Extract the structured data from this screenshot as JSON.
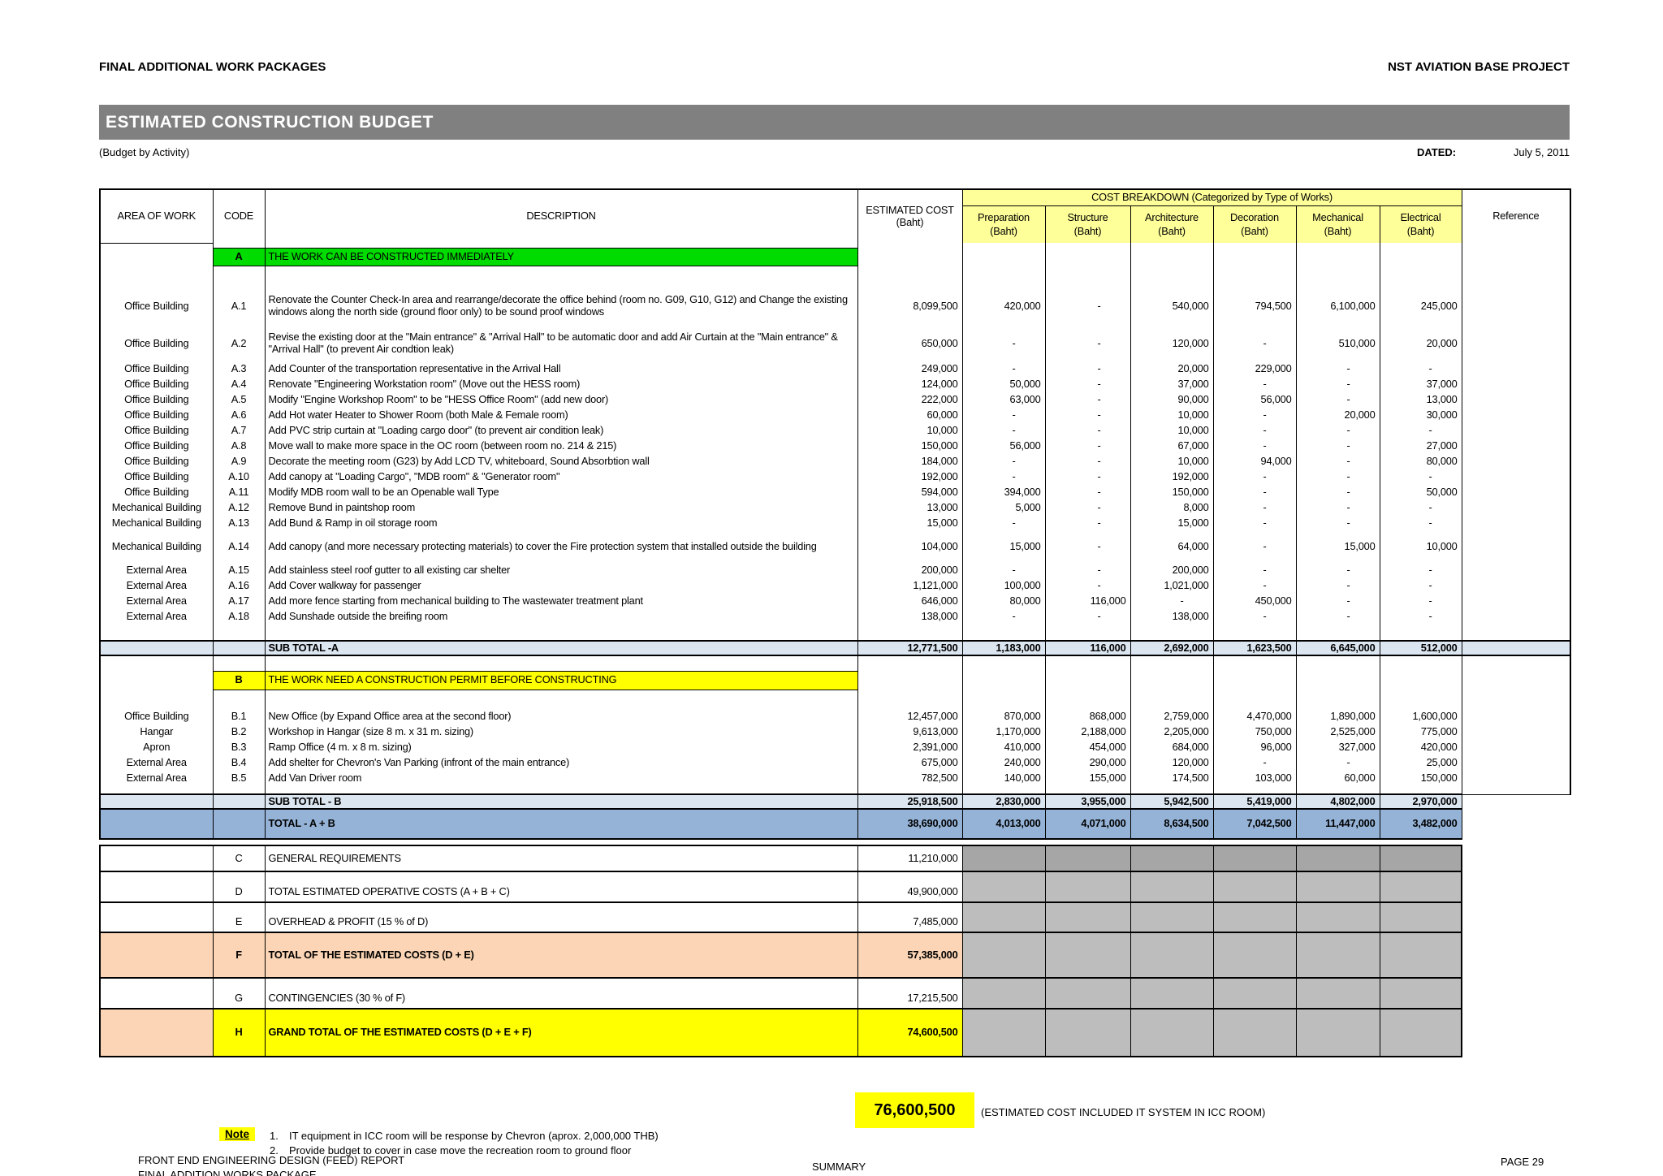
{
  "header": {
    "left_title": "FINAL ADDITIONAL WORK PACKAGES",
    "right_title": "NST AVIATION BASE PROJECT",
    "bar_title": "ESTIMATED CONSTRUCTION BUDGET",
    "subtitle": "(Budget by Activity)",
    "dated_label": "DATED:",
    "dated_value": "July 5, 2011"
  },
  "table": {
    "headers": {
      "area": "AREA OF WORK",
      "code": "CODE",
      "desc": "DESCRIPTION",
      "est_line1": "ESTIMATED COST",
      "est_line2": "(Baht)",
      "breakdown": "COST BREAKDOWN (Categorized by Type of Works)",
      "cols": [
        {
          "title": "Preparation",
          "unit": "(Baht)"
        },
        {
          "title": "Structure",
          "unit": "(Baht)"
        },
        {
          "title": "Architecture",
          "unit": "(Baht)"
        },
        {
          "title": "Decoration",
          "unit": "(Baht)"
        },
        {
          "title": "Mechanical",
          "unit": "(Baht)"
        },
        {
          "title": "Electrical",
          "unit": "(Baht)"
        }
      ],
      "reference": "Reference"
    },
    "section_a": {
      "code": "A",
      "title": "THE WORK CAN BE CONSTRUCTED IMMEDIATELY",
      "items": [
        {
          "area": "Office Building",
          "code": "A.1",
          "desc": "Renovate the Counter Check-In area and rearrange/decorate the office behind (room no. G09, G10, G12) and Change the existing windows along the north side (ground floor only) to be sound proof windows",
          "est": "8,099,500",
          "prep": "420,000",
          "str": "-",
          "arch": "540,000",
          "dec": "794,500",
          "mech": "6,100,000",
          "elec": "245,000"
        },
        {
          "area": "Office Building",
          "code": "A.2",
          "desc": "Revise the existing door at the \"Main entrance\" & \"Arrival Hall\" to be automatic door and add Air Curtain at the \"Main entrance\" & \"Arrival Hall\" (to prevent Air condtion leak)",
          "est": "650,000",
          "prep": "-",
          "str": "-",
          "arch": "120,000",
          "dec": "-",
          "mech": "510,000",
          "elec": "20,000"
        },
        {
          "area": "Office Building",
          "code": "A.3",
          "desc": "Add Counter of the transportation representative in the Arrival Hall",
          "est": "249,000",
          "prep": "-",
          "str": "-",
          "arch": "20,000",
          "dec": "229,000",
          "mech": "-",
          "elec": "-"
        },
        {
          "area": "Office Building",
          "code": "A.4",
          "desc": "Renovate \"Engineering Workstation room\" (Move out the HESS room)",
          "est": "124,000",
          "prep": "50,000",
          "str": "-",
          "arch": "37,000",
          "dec": "-",
          "mech": "-",
          "elec": "37,000"
        },
        {
          "area": "Office Building",
          "code": "A.5",
          "desc": "Modify \"Engine Workshop Room\" to be \"HESS Office Room\" (add new door)",
          "est": "222,000",
          "prep": "63,000",
          "str": "-",
          "arch": "90,000",
          "dec": "56,000",
          "mech": "-",
          "elec": "13,000"
        },
        {
          "area": "Office Building",
          "code": "A.6",
          "desc": "Add Hot water Heater to Shower Room (both Male & Female room)",
          "est": "60,000",
          "prep": "-",
          "str": "-",
          "arch": "10,000",
          "dec": "-",
          "mech": "20,000",
          "elec": "30,000"
        },
        {
          "area": "Office Building",
          "code": "A.7",
          "desc": "Add PVC strip curtain at \"Loading cargo door\" (to prevent air condition leak)",
          "est": "10,000",
          "prep": "-",
          "str": "-",
          "arch": "10,000",
          "dec": "-",
          "mech": "-",
          "elec": "-"
        },
        {
          "area": "Office Building",
          "code": "A.8",
          "desc": "Move wall to make more space in the OC room (between room no. 214 & 215)",
          "est": "150,000",
          "prep": "56,000",
          "str": "-",
          "arch": "67,000",
          "dec": "-",
          "mech": "-",
          "elec": "27,000"
        },
        {
          "area": "Office Building",
          "code": "A.9",
          "desc": "Decorate the meeting room (G23) by Add LCD TV, whiteboard, Sound Absorbtion wall",
          "est": "184,000",
          "prep": "-",
          "str": "-",
          "arch": "10,000",
          "dec": "94,000",
          "mech": "-",
          "elec": "80,000"
        },
        {
          "area": "Office Building",
          "code": "A.10",
          "desc": "Add canopy at \"Loading Cargo\", \"MDB room\" & \"Generator room\"",
          "est": "192,000",
          "prep": "-",
          "str": "-",
          "arch": "192,000",
          "dec": "-",
          "mech": "-",
          "elec": "-"
        },
        {
          "area": "Office Building",
          "code": "A.11",
          "desc": "Modify MDB room wall to be an Openable wall Type",
          "est": "594,000",
          "prep": "394,000",
          "str": "-",
          "arch": "150,000",
          "dec": "-",
          "mech": "-",
          "elec": "50,000"
        },
        {
          "area": "Mechanical Building",
          "code": "A.12",
          "desc": "Remove Bund in paintshop room",
          "est": "13,000",
          "prep": "5,000",
          "str": "-",
          "arch": "8,000",
          "dec": "-",
          "mech": "-",
          "elec": "-"
        },
        {
          "area": "Mechanical Building",
          "code": "A.13",
          "desc": "Add Bund & Ramp in oil storage room",
          "est": "15,000",
          "prep": "-",
          "str": "-",
          "arch": "15,000",
          "dec": "-",
          "mech": "-",
          "elec": "-"
        },
        {
          "area": "Mechanical Building",
          "code": "A.14",
          "desc": "Add canopy (and more necessary protecting materials) to cover the Fire protection system that installed outside the building",
          "est": "104,000",
          "prep": "15,000",
          "str": "-",
          "arch": "64,000",
          "dec": "-",
          "mech": "15,000",
          "elec": "10,000"
        },
        {
          "area": "External Area",
          "code": "A.15",
          "desc": "Add stainless steel roof gutter to all existing car shelter",
          "est": "200,000",
          "prep": "-",
          "str": "-",
          "arch": "200,000",
          "dec": "-",
          "mech": "-",
          "elec": "-"
        },
        {
          "area": "External Area",
          "code": "A.16",
          "desc": "Add Cover walkway for passenger",
          "est": "1,121,000",
          "prep": "100,000",
          "str": "-",
          "arch": "1,021,000",
          "dec": "-",
          "mech": "-",
          "elec": "-"
        },
        {
          "area": "External Area",
          "code": "A.17",
          "desc": "Add more fence starting from mechanical building to The wastewater treatment plant",
          "est": "646,000",
          "prep": "80,000",
          "str": "116,000",
          "arch": "-",
          "dec": "450,000",
          "mech": "-",
          "elec": "-"
        },
        {
          "area": "External Area",
          "code": "A.18",
          "desc": "Add Sunshade outside the breifing room",
          "est": "138,000",
          "prep": "-",
          "str": "-",
          "arch": "138,000",
          "dec": "-",
          "mech": "-",
          "elec": "-"
        }
      ],
      "subtotal": {
        "label": "SUB TOTAL -A",
        "est": "12,771,500",
        "prep": "1,183,000",
        "str": "116,000",
        "arch": "2,692,000",
        "dec": "1,623,500",
        "mech": "6,645,000",
        "elec": "512,000"
      }
    },
    "section_b": {
      "code": "B",
      "title": "THE WORK NEED A CONSTRUCTION PERMIT BEFORE CONSTRUCTING",
      "items": [
        {
          "area": "Office Building",
          "code": "B.1",
          "desc": "New Office (by Expand Office area at the second floor)",
          "est": "12,457,000",
          "prep": "870,000",
          "str": "868,000",
          "arch": "2,759,000",
          "dec": "4,470,000",
          "mech": "1,890,000",
          "elec": "1,600,000"
        },
        {
          "area": "Hangar",
          "code": "B.2",
          "desc": "Workshop in Hangar (size 8 m. x 31 m. sizing)",
          "est": "9,613,000",
          "prep": "1,170,000",
          "str": "2,188,000",
          "arch": "2,205,000",
          "dec": "750,000",
          "mech": "2,525,000",
          "elec": "775,000"
        },
        {
          "area": "Apron",
          "code": "B.3",
          "desc": "Ramp Office (4 m. x 8 m. sizing)",
          "est": "2,391,000",
          "prep": "410,000",
          "str": "454,000",
          "arch": "684,000",
          "dec": "96,000",
          "mech": "327,000",
          "elec": "420,000"
        },
        {
          "area": "External Area",
          "code": "B.4",
          "desc": "Add shelter for Chevron's Van Parking (infront of the main entrance)",
          "est": "675,000",
          "prep": "240,000",
          "str": "290,000",
          "arch": "120,000",
          "dec": "-",
          "mech": "-",
          "elec": "25,000"
        },
        {
          "area": "External Area",
          "code": "B.5",
          "desc": "Add Van Driver room",
          "est": "782,500",
          "prep": "140,000",
          "str": "155,000",
          "arch": "174,500",
          "dec": "103,000",
          "mech": "60,000",
          "elec": "150,000"
        }
      ],
      "subtotal": {
        "label": "SUB TOTAL - B",
        "est": "25,918,500",
        "prep": "2,830,000",
        "str": "3,955,000",
        "arch": "5,942,500",
        "dec": "5,419,000",
        "mech": "4,802,000",
        "elec": "2,970,000"
      },
      "total": {
        "label": "TOTAL - A + B",
        "est": "38,690,000",
        "prep": "4,013,000",
        "str": "4,071,000",
        "arch": "8,634,500",
        "dec": "7,042,500",
        "mech": "11,447,000",
        "elec": "3,482,000"
      }
    },
    "summary_rows": [
      {
        "code": "C",
        "desc": "GENERAL REQUIREMENTS",
        "est": "11,210,000"
      },
      {
        "code": "D",
        "desc": "TOTAL ESTIMATED OPERATIVE COSTS (A + B + C)",
        "est": "49,900,000"
      },
      {
        "code": "E",
        "desc": "OVERHEAD & PROFIT (15 % of D)",
        "est": "7,485,000"
      },
      {
        "code": "F",
        "desc": "TOTAL OF THE ESTIMATED COSTS (D + E)",
        "est": "57,385,000"
      },
      {
        "code": "G",
        "desc": "CONTINGENCIES (30 % of F)",
        "est": "17,215,500"
      },
      {
        "code": "H",
        "desc": "GRAND TOTAL OF THE ESTIMATED COSTS (D + E + F)",
        "est": "74,600,500"
      }
    ]
  },
  "bottom": {
    "grand_value": "76,600,500",
    "grand_caption": "(ESTIMATED COST INCLUDED IT SYSTEM IN ICC ROOM)",
    "note_label": "Note",
    "notes": [
      {
        "no": "1.",
        "text": "IT equipment in ICC room will be response by Chevron (aprox. 2,000,000 THB)"
      },
      {
        "no": "2.",
        "text": "Provide budget to cover in case move the recreation room to ground floor"
      }
    ],
    "footer_line1": "FRONT END ENGINEERING DESIGN (FEED) REPORT",
    "footer_line2": "FINAL ADDITION WORKS PACKAGE",
    "summary_label": "SUMMARY",
    "page_label": "PAGE 29"
  }
}
